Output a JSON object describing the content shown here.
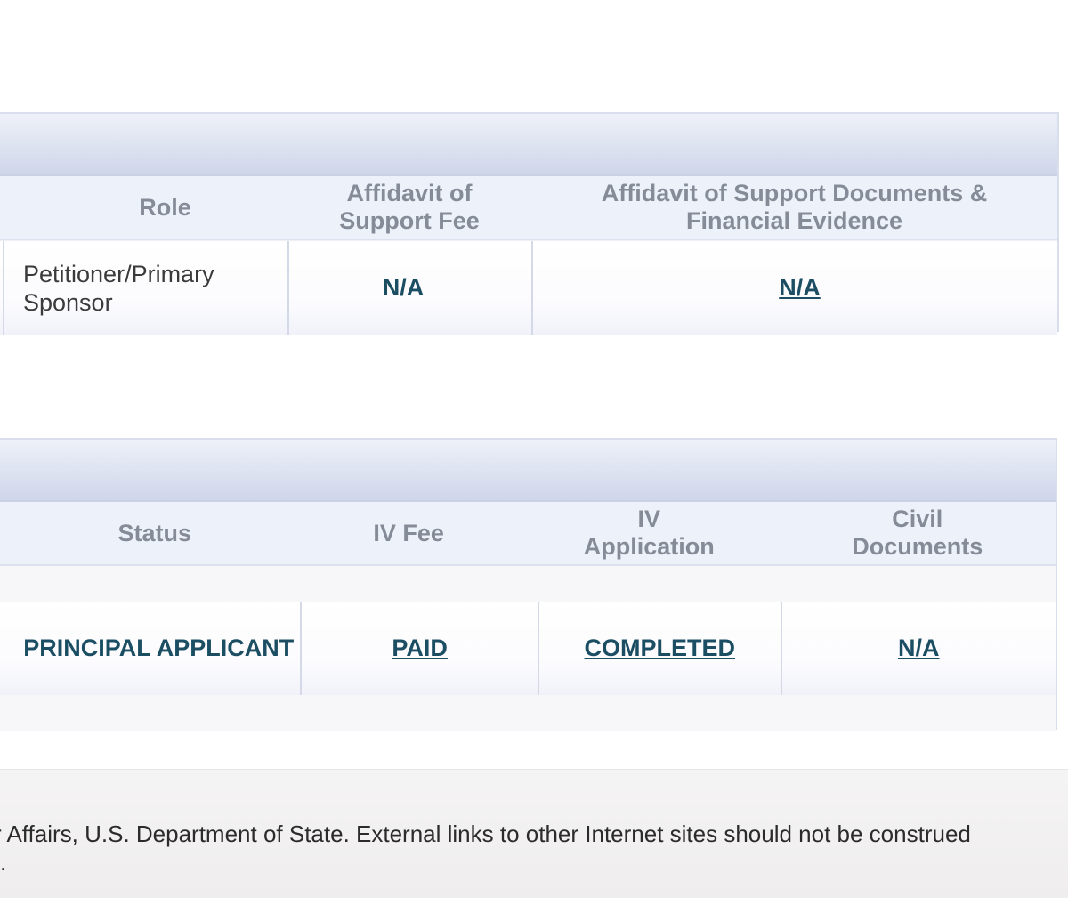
{
  "sponsor_table": {
    "headers": {
      "role": "Role",
      "aos_fee": "Affidavit of Support Fee",
      "aos_docs": "Affidavit of Support Documents & Financial Evidence"
    },
    "row": {
      "role": "Petitioner/Primary Sponsor",
      "aos_fee": "N/A",
      "aos_docs": "N/A"
    }
  },
  "applicant_table": {
    "headers": {
      "status": "Status",
      "iv_fee": "IV Fee",
      "iv_application": "IV Application",
      "civil_documents": "Civil Documents"
    },
    "row": {
      "status": "PRINCIPAL APPLICANT",
      "iv_fee": "PAID",
      "iv_application": "COMPLETED",
      "civil_documents": "N/A"
    }
  },
  "footer": {
    "line1": "r Affairs, U.S. Department of State. External links to other Internet sites should not be construed",
    "line2": "."
  }
}
